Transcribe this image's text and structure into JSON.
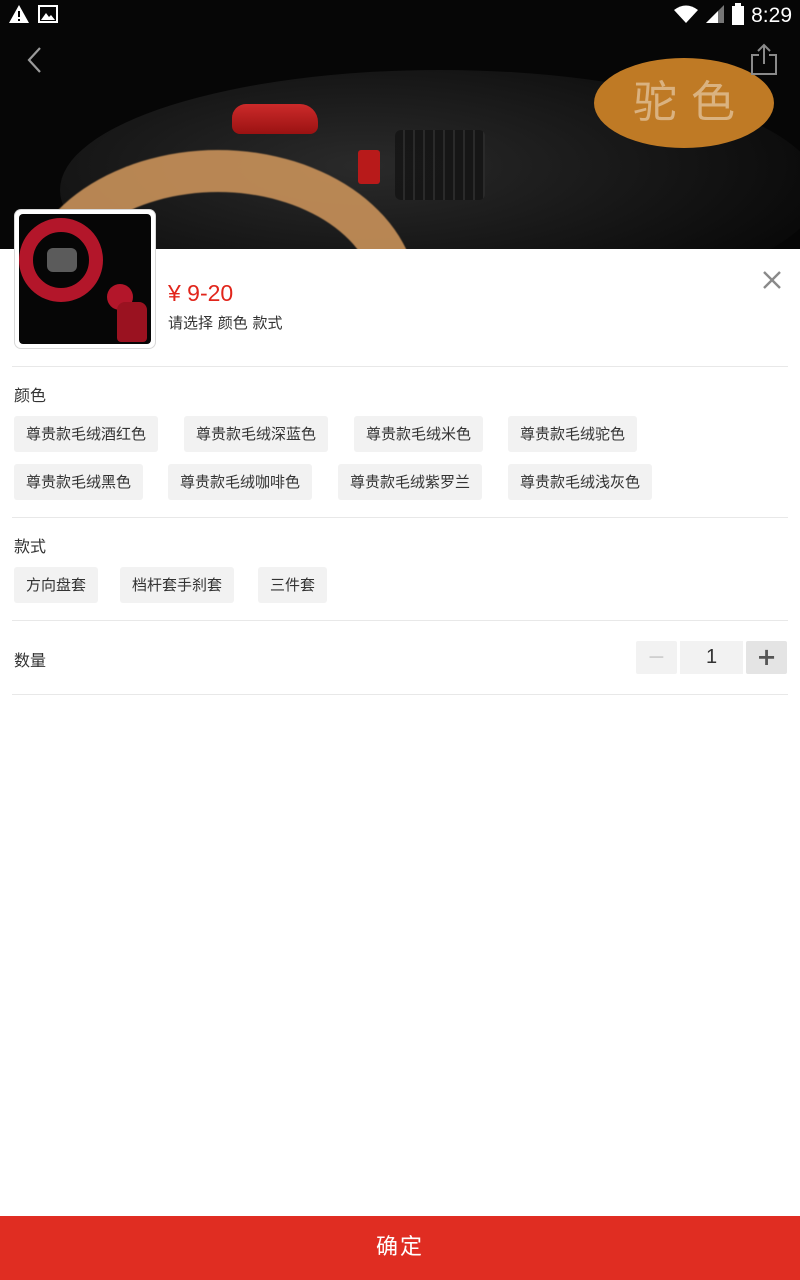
{
  "status_bar": {
    "time": "8:29",
    "left_icons": [
      "warning-icon",
      "image-icon"
    ],
    "right_icons": [
      "wifi-icon",
      "signal-icon",
      "battery-icon"
    ]
  },
  "banner": {
    "color_tag_text": "驼色"
  },
  "nav": {
    "back_icon": "chevron-left-icon",
    "share_icon": "share-icon"
  },
  "product": {
    "price": "¥ 9-20",
    "select_hint": "请选择 颜色 款式"
  },
  "color_section": {
    "title": "颜色",
    "options": [
      "尊贵款毛绒酒红色",
      "尊贵款毛绒深蓝色",
      "尊贵款毛绒米色",
      "尊贵款毛绒驼色",
      "尊贵款毛绒黑色",
      "尊贵款毛绒咖啡色",
      "尊贵款毛绒紫罗兰",
      "尊贵款毛绒浅灰色"
    ]
  },
  "style_section": {
    "title": "款式",
    "options": [
      "方向盘套",
      "档杆套手刹套",
      "三件套"
    ]
  },
  "quantity": {
    "label": "数量",
    "value": "1",
    "minus": "−",
    "plus": "+"
  },
  "confirm": {
    "label": "确定"
  },
  "colors": {
    "accent_red": "#e1251b",
    "confirm_bg": "#e02d22",
    "chip_bg": "#f2f2f2"
  }
}
